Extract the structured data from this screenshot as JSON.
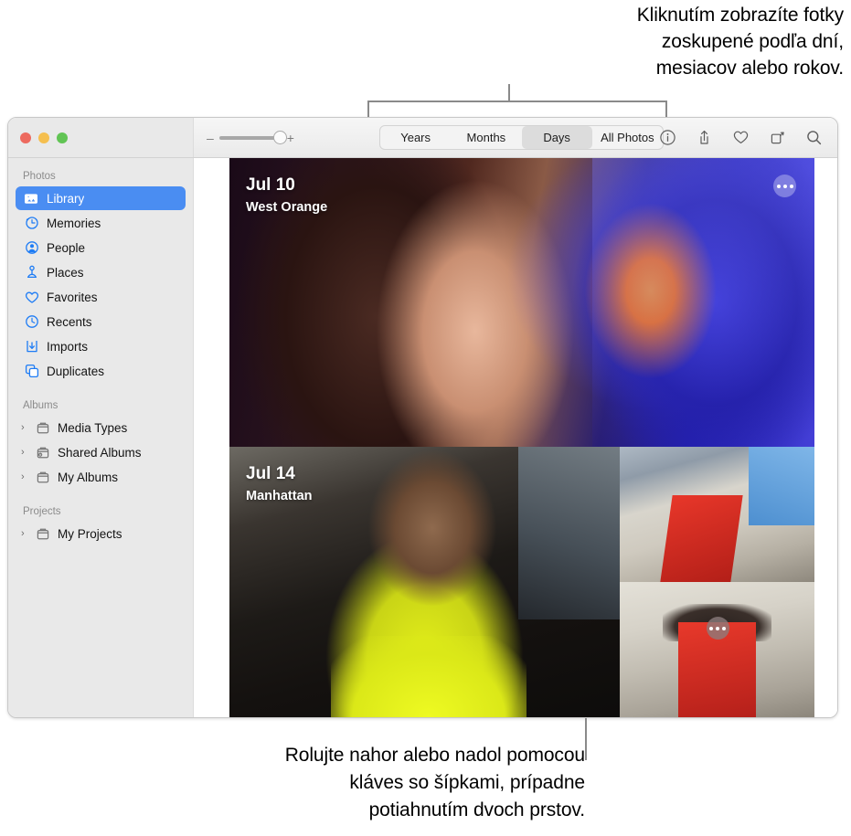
{
  "callouts": {
    "top": "Kliknutím zobrazíte fotky\nzoskupené podľa dní,\nmesiacov alebo rokov.",
    "bottom": "Rolujte nahor alebo nadol pomocou\nkláves so šípkami, prípadne\npotiahnutím dvoch prstov."
  },
  "window": {
    "traffic_lights": {
      "close": "close-button",
      "minimize": "minimize-button",
      "zoom": "zoom-button"
    }
  },
  "toolbar": {
    "zoom_slider": {
      "minus": "–",
      "plus": "+",
      "value": 100
    },
    "segments": [
      {
        "label": "Years",
        "selected": false
      },
      {
        "label": "Months",
        "selected": false
      },
      {
        "label": "Days",
        "selected": true
      },
      {
        "label": "All Photos",
        "selected": false
      }
    ],
    "icons": [
      {
        "name": "info-icon"
      },
      {
        "name": "share-icon"
      },
      {
        "name": "favorite-heart-icon"
      },
      {
        "name": "rotate-icon"
      },
      {
        "name": "search-icon"
      }
    ]
  },
  "sidebar": {
    "sections": [
      {
        "header": "Photos",
        "items": [
          {
            "label": "Library",
            "icon": "library-icon",
            "selected": true,
            "disclosure": false
          },
          {
            "label": "Memories",
            "icon": "memories-icon",
            "selected": false,
            "disclosure": false
          },
          {
            "label": "People",
            "icon": "people-icon",
            "selected": false,
            "disclosure": false
          },
          {
            "label": "Places",
            "icon": "places-pin-icon",
            "selected": false,
            "disclosure": false
          },
          {
            "label": "Favorites",
            "icon": "heart-icon",
            "selected": false,
            "disclosure": false
          },
          {
            "label": "Recents",
            "icon": "clock-icon",
            "selected": false,
            "disclosure": false
          },
          {
            "label": "Imports",
            "icon": "import-icon",
            "selected": false,
            "disclosure": false
          },
          {
            "label": "Duplicates",
            "icon": "duplicates-icon",
            "selected": false,
            "disclosure": false
          }
        ]
      },
      {
        "header": "Albums",
        "items": [
          {
            "label": "Media Types",
            "icon": "folder-icon",
            "selected": false,
            "disclosure": true
          },
          {
            "label": "Shared Albums",
            "icon": "shared-folder-icon",
            "selected": false,
            "disclosure": true
          },
          {
            "label": "My Albums",
            "icon": "folder-icon",
            "selected": false,
            "disclosure": true
          }
        ]
      },
      {
        "header": "Projects",
        "items": [
          {
            "label": "My Projects",
            "icon": "folder-icon",
            "selected": false,
            "disclosure": true
          }
        ]
      }
    ],
    "disclosure_glyph": "›"
  },
  "photo_grid": {
    "days": [
      {
        "title": "Jul 10",
        "place": "West Orange"
      },
      {
        "title": "Jul 14",
        "place": "Manhattan"
      }
    ],
    "more_button_label": "•••"
  },
  "colors": {
    "accent": "#4a8df2",
    "sidebar_bg": "#e9e9e9",
    "titlebar_bg": "#eaeaea",
    "segment_selected": "#dcdcdc",
    "callout_line": "#8a8a8a"
  }
}
